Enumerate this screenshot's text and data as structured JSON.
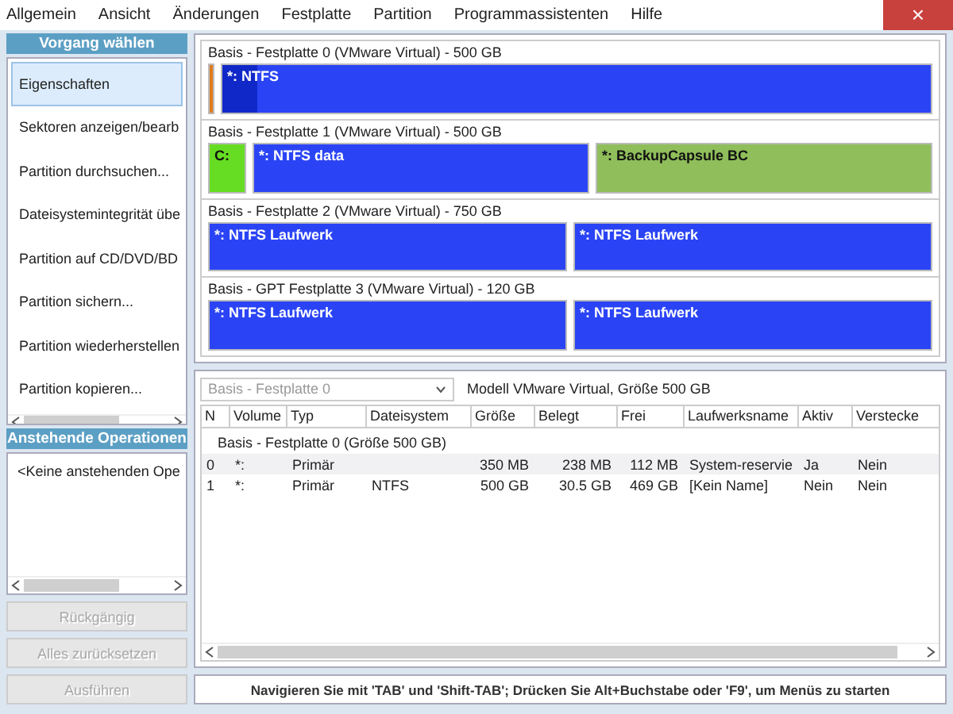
{
  "menu": [
    "Allgemein",
    "Ansicht",
    "Änderungen",
    "Festplatte",
    "Partition",
    "Programmassistenten",
    "Hilfe"
  ],
  "close_button": "×",
  "operations": {
    "title": "Vorgang wählen",
    "items": [
      {
        "label": "Eigenschaften",
        "selected": true
      },
      {
        "label": "Sektoren anzeigen/bearb",
        "selected": false
      },
      {
        "label": "Partition durchsuchen...",
        "selected": false
      },
      {
        "label": "Dateisystemintegrität übe",
        "selected": false
      },
      {
        "label": "Partition auf CD/DVD/BD",
        "selected": false
      },
      {
        "label": "Partition sichern...",
        "selected": false
      },
      {
        "label": "Partition wiederherstellen",
        "selected": false
      },
      {
        "label": "Partition kopieren...",
        "selected": false
      }
    ]
  },
  "pending": {
    "title": "Anstehende Operationen",
    "items": [
      "<Keine anstehenden Ope"
    ]
  },
  "buttons": [
    {
      "label": "Rückgängig",
      "disabled": true
    },
    {
      "label": "Alles zurücksetzen",
      "disabled": true
    },
    {
      "label": "Ausführen",
      "disabled": true
    }
  ],
  "disks": [
    {
      "title": "Basis -  Festplatte 0 (VMware Virtual) - 500 GB",
      "partitions": [
        {
          "kind": "strip",
          "color": "#e07b1c"
        },
        {
          "kind": "wide",
          "label": "*: NTFS",
          "color": "#2a44f5",
          "level": 0.05
        }
      ]
    },
    {
      "title": "Basis -  Festplatte 1 (VMware Virtual) - 500 GB",
      "partitions": [
        {
          "kind": "narrow",
          "label": "C:",
          "color": "#66dd22"
        },
        {
          "kind": "wide",
          "label": "*: NTFS data",
          "color": "#2a44f5"
        },
        {
          "kind": "wide",
          "label": "*: BackupCapsule BC",
          "color": "#8fbe5a"
        }
      ]
    },
    {
      "title": "Basis -  Festplatte 2 (VMware Virtual) - 750 GB",
      "partitions": [
        {
          "kind": "wide",
          "label": "*: NTFS Laufwerk",
          "color": "#2a44f5"
        },
        {
          "kind": "wide",
          "label": "*: NTFS Laufwerk",
          "color": "#2a44f5"
        }
      ]
    },
    {
      "title": "Basis -  GPT Festplatte 3 (VMware Virtual) - 120 GB",
      "partitions": [
        {
          "kind": "wide",
          "label": "*: NTFS Laufwerk",
          "color": "#2a44f5"
        },
        {
          "kind": "wide",
          "label": "*: NTFS Laufwerk",
          "color": "#2a44f5"
        }
      ]
    }
  ],
  "disk_select": {
    "value": "Basis -  Festplatte 0",
    "model": "Modell VMware Virtual, Größe 500 GB"
  },
  "table": {
    "columns": [
      "N",
      "Volume",
      "Typ",
      "Dateisystem",
      "Größe",
      "Belegt",
      "Frei",
      "Laufwerksname",
      "Aktiv",
      "Verstecke"
    ],
    "group": "Basis -  Festplatte 0 (Größe 500 GB)",
    "rows": [
      {
        "selected": true,
        "cells": [
          "0",
          "*:",
          "Primär",
          "",
          "350 MB",
          "238 MB",
          "112 MB",
          "System-reservie",
          "Ja",
          "Nein"
        ]
      },
      {
        "selected": false,
        "cells": [
          "1",
          "*:",
          "Primär",
          "NTFS",
          "500 GB",
          "30.5 GB",
          "469 GB",
          "[Kein Name]",
          "Nein",
          "Nein"
        ]
      }
    ]
  },
  "status_bar": "Navigieren Sie mit 'TAB' und 'Shift-TAB'; Drücken Sie Alt+Buchstabe oder 'F9', um Menüs zu starten"
}
